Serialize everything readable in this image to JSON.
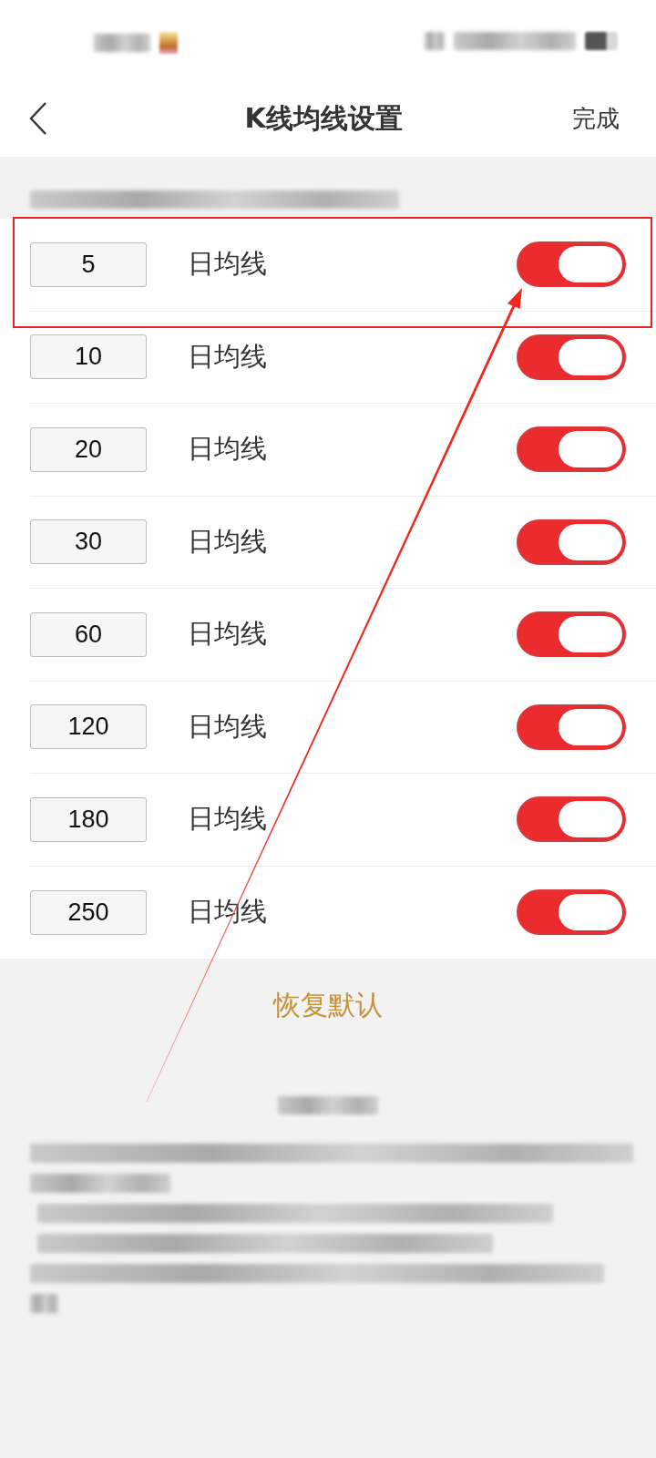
{
  "nav": {
    "title": "K线均线设置",
    "done": "完成"
  },
  "lines": [
    {
      "period": "5",
      "label": "日均线",
      "on": true,
      "annotated": true
    },
    {
      "period": "10",
      "label": "日均线",
      "on": true,
      "annotated": false
    },
    {
      "period": "20",
      "label": "日均线",
      "on": true,
      "annotated": false
    },
    {
      "period": "30",
      "label": "日均线",
      "on": true,
      "annotated": false
    },
    {
      "period": "60",
      "label": "日均线",
      "on": true,
      "annotated": false
    },
    {
      "period": "120",
      "label": "日均线",
      "on": true,
      "annotated": false
    },
    {
      "period": "180",
      "label": "日均线",
      "on": true,
      "annotated": false
    },
    {
      "period": "250",
      "label": "日均线",
      "on": true,
      "annotated": false
    }
  ],
  "restore_button": "恢复默认"
}
